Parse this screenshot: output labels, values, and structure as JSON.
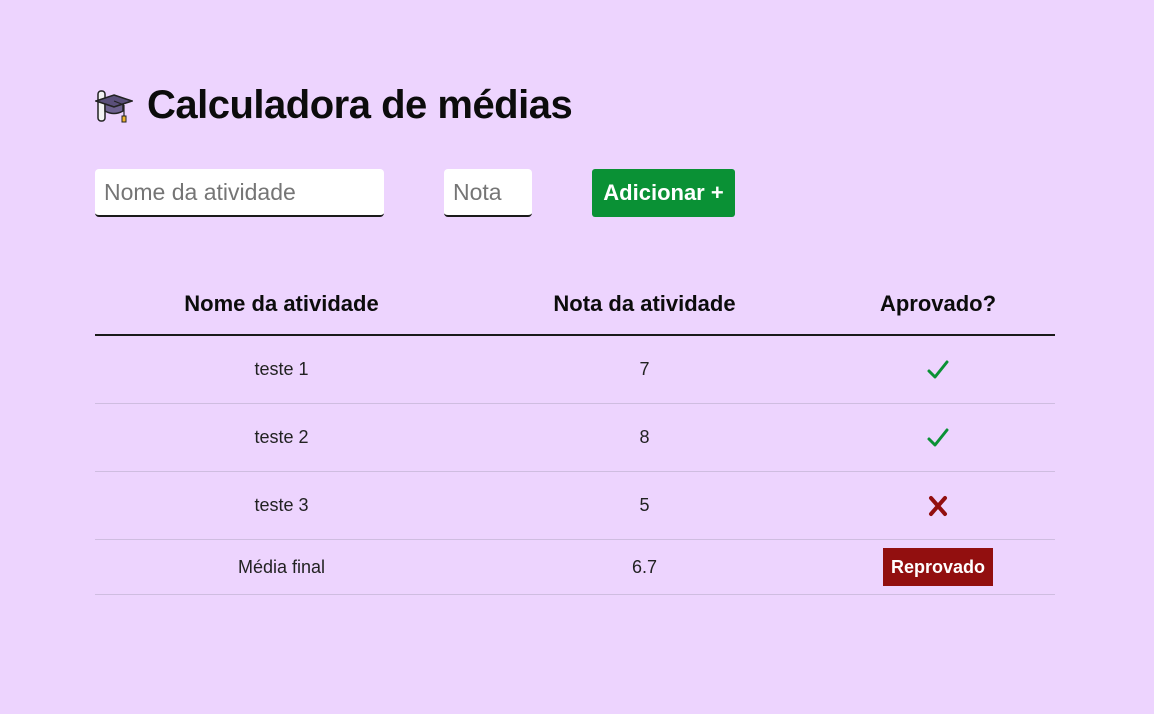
{
  "header": {
    "icon": "graduation-cap-icon",
    "title": "Calculadora de médias"
  },
  "form": {
    "name_placeholder": "Nome da atividade",
    "name_value": "",
    "grade_placeholder": "Nota",
    "grade_value": "",
    "add_label": "Adicionar +"
  },
  "table": {
    "columns": [
      "Nome da atividade",
      "Nota da atividade",
      "Aprovado?"
    ],
    "rows": [
      {
        "name": "teste 1",
        "grade": "7",
        "approved": true,
        "icon": "check-icon"
      },
      {
        "name": "teste 2",
        "grade": "8",
        "approved": true,
        "icon": "check-icon"
      },
      {
        "name": "teste 3",
        "grade": "5",
        "approved": false,
        "icon": "cross-icon"
      }
    ],
    "final": {
      "label": "Média final",
      "value": "6.7",
      "result": "Reprovado"
    }
  },
  "colors": {
    "background": "#edd4fe",
    "add_button": "#0a9135",
    "approved": "#0a9135",
    "failed": "#920f0f"
  }
}
